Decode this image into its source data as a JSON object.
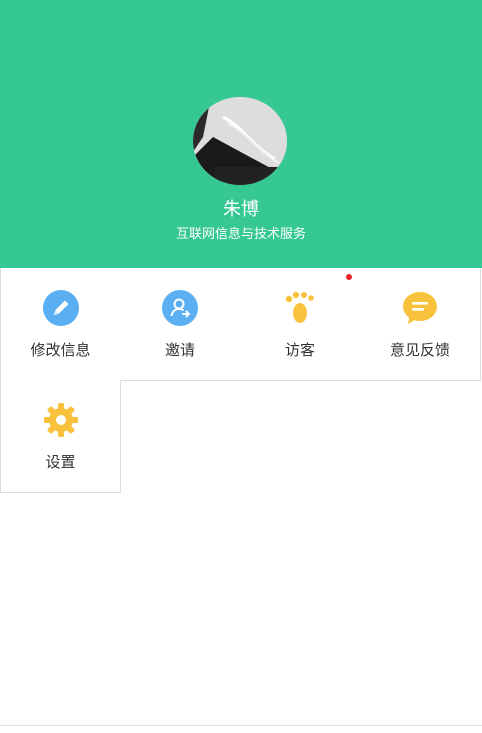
{
  "profile": {
    "name": "朱博",
    "company": "互联网信息与技术服务"
  },
  "menu": {
    "items": [
      {
        "label": "修改信息",
        "icon": "edit-pencil-icon"
      },
      {
        "label": "邀请",
        "icon": "invite-user-icon"
      },
      {
        "label": "访客",
        "icon": "footprint-icon",
        "badge": true
      },
      {
        "label": "意见反馈",
        "icon": "feedback-chat-icon"
      },
      {
        "label": "设置",
        "icon": "settings-gear-icon"
      }
    ]
  },
  "colors": {
    "header_bg": "#35c893",
    "icon_blue": "#5aaef2",
    "icon_yellow": "#f9c23c",
    "badge_red": "#e5252a"
  }
}
